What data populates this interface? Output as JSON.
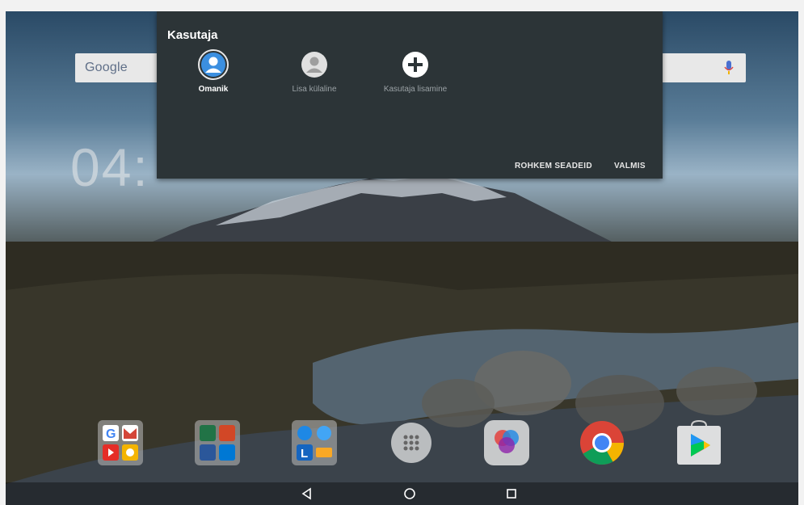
{
  "home": {
    "search": {
      "logo_text": "Google",
      "mic_icon": "mic-icon"
    },
    "clock_text": "04:"
  },
  "user_panel": {
    "title": "Kasutaja",
    "users": [
      {
        "label": "Omanik",
        "icon": "owner-avatar-icon",
        "active": true
      },
      {
        "label": "Lisa külaline",
        "icon": "guest-avatar-icon",
        "active": false
      },
      {
        "label": "Kasutaja lisamine",
        "icon": "add-user-icon",
        "active": false
      }
    ],
    "more_settings_label": "ROHKEM SEADEID",
    "done_label": "VALMIS"
  },
  "dock": {
    "apps": [
      {
        "name": "google-folder-icon"
      },
      {
        "name": "office-folder-icon"
      },
      {
        "name": "tools-folder-icon"
      },
      {
        "name": "app-drawer-icon"
      },
      {
        "name": "color-app-icon"
      },
      {
        "name": "chrome-icon"
      },
      {
        "name": "play-store-icon"
      }
    ]
  },
  "navbar": {
    "back": "back-icon",
    "home": "home-icon",
    "recents": "recents-icon"
  },
  "colors": {
    "panel_bg": "#2c3437",
    "accent_blue": "#3b8fe0"
  }
}
